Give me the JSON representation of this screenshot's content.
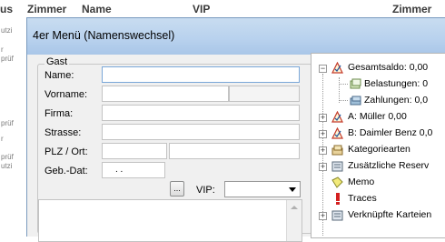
{
  "background": {
    "columns": [
      "us",
      "Zimmer",
      "Name",
      "VIP",
      "Zimmer"
    ],
    "row_fragments": [
      "utzi",
      "r",
      "prüf",
      "prüf",
      "r",
      "prüf",
      "utzi"
    ]
  },
  "dialog": {
    "title": "4er Menü (Namenswechsel)",
    "group_label": "Gast",
    "fields": {
      "name_label": "Name:",
      "vorname_label": "Vorname:",
      "firma_label": "Firma:",
      "strasse_label": "Strasse:",
      "plz_ort_label": "PLZ / Ort:",
      "geb_dat_label": "Geb.-Dat:",
      "geb_dat_value": ".  .",
      "dots_button": "...",
      "vip_label": "VIP:",
      "vip_value": ""
    }
  },
  "tree": {
    "items": [
      {
        "label": "Gesamtsaldo: 0,00",
        "icon": "saldo-icon"
      },
      {
        "label": "Belastungen: 0",
        "icon": "belastungen-icon"
      },
      {
        "label": "Zahlungen: 0,0",
        "icon": "zahlungen-icon"
      },
      {
        "label": "A: Müller 0,00",
        "icon": "account-icon"
      },
      {
        "label": "B: Daimler Benz 0,0",
        "icon": "account-icon"
      },
      {
        "label": "Kategoriearten",
        "icon": "category-icon"
      },
      {
        "label": "Zusätzliche Reserv",
        "icon": "reservation-icon"
      },
      {
        "label": "Memo",
        "icon": "memo-icon"
      },
      {
        "label": "Traces",
        "icon": "traces-icon"
      },
      {
        "label": "Verknüpfte Karteien",
        "icon": "linked-files-icon"
      }
    ]
  },
  "colors": {
    "titlebar": "#b9d2ee",
    "dialog_bg": "#f0f0f0",
    "focus_border": "#7aa7d8"
  }
}
